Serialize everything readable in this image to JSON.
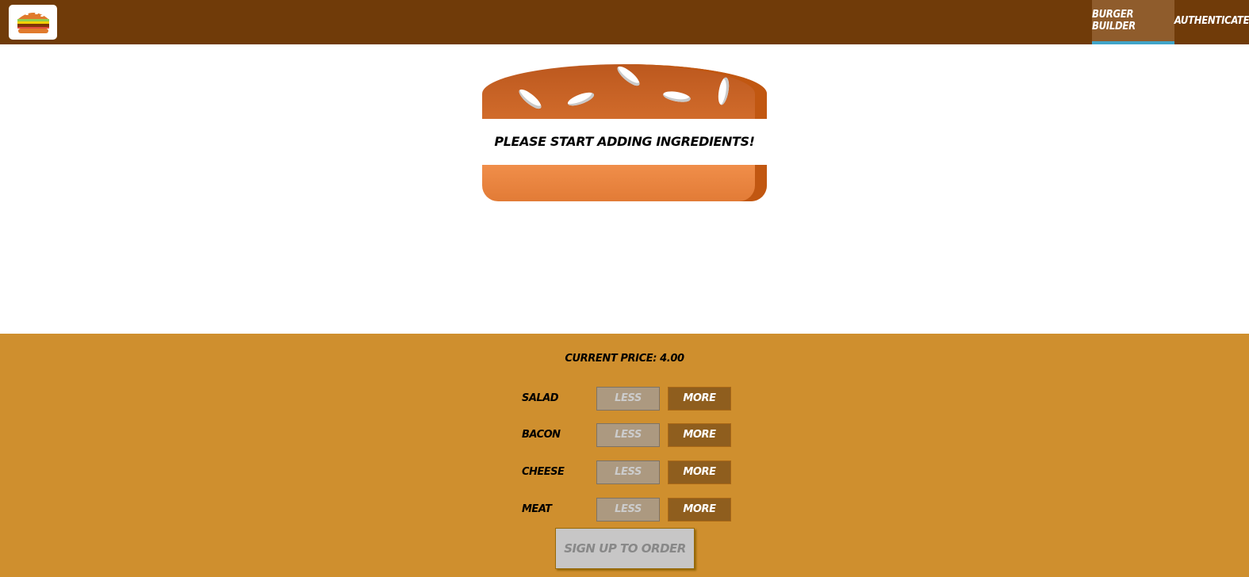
{
  "toolbar": {
    "logo_icon": "burger-logo-icon",
    "nav": [
      {
        "label": "Burger Builder",
        "active": true
      },
      {
        "label": "Authenticate",
        "active": false
      }
    ]
  },
  "burger": {
    "message": "Please start adding ingredients!"
  },
  "controls": {
    "price_label": "Current Price: 4.00",
    "ingredients": [
      {
        "label": "Salad",
        "less": "Less",
        "more": "More"
      },
      {
        "label": "Bacon",
        "less": "Less",
        "more": "More"
      },
      {
        "label": "Cheese",
        "less": "Less",
        "more": "More"
      },
      {
        "label": "Meat",
        "less": "Less",
        "more": "More"
      }
    ],
    "order_button": "Sign up to order"
  },
  "colors": {
    "toolbar": "#703b09",
    "nav_active": "#8f5c2c",
    "nav_active_border": "#40a4c8",
    "controls_bg": "#cf8f2e",
    "more_button": "#8f5e1e",
    "less_button_disabled": "#ac9980",
    "order_button_disabled": "#c7c6c6"
  }
}
